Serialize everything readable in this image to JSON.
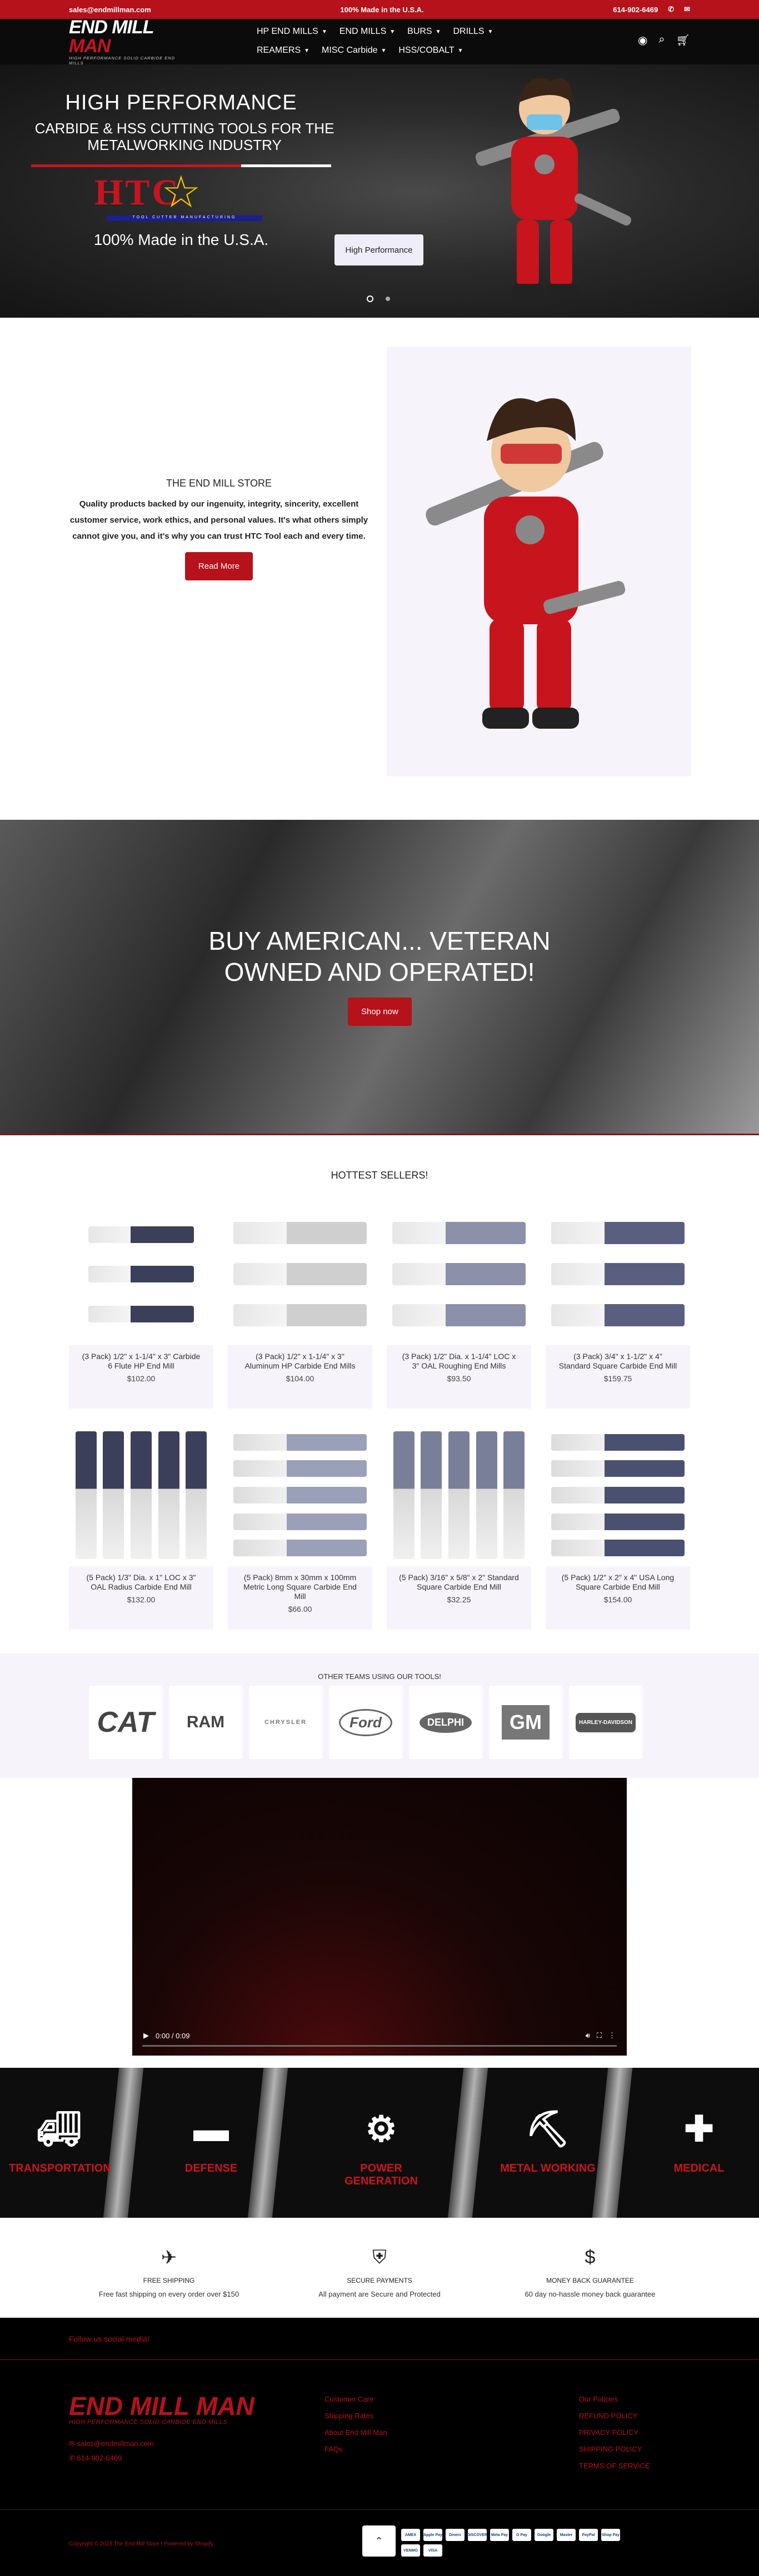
{
  "topbar": {
    "email": "sales@endmillman.com",
    "message": "100% Made in the U.S.A.",
    "phone": "614-902-6469",
    "icons": [
      "phone-icon",
      "mail-icon"
    ]
  },
  "header": {
    "logo_text_1": "END MILL ",
    "logo_text_2": "MAN",
    "logo_tagline": "HIGH PERFORMANCE SOLID CARBIDE END MILLS",
    "nav": [
      "HP END MILLS",
      "END MILLS",
      "BURS",
      "DRILLS",
      "REAMERS",
      "MISC Carbide",
      "HSS/COBALT"
    ],
    "icons": [
      "account-icon",
      "search-icon",
      "cart-icon"
    ]
  },
  "hero": {
    "title": "HIGH PERFORMANCE",
    "subtitle": "CARBIDE & HSS CUTTING TOOLS FOR THE METALWORKING INDUSTRY",
    "brand": "HTC",
    "brand_tagline": "TOOL CUTTER MANUFACTURING",
    "made": "100% Made in the U.S.A.",
    "button": "High Performance",
    "slide": "1 of 2"
  },
  "about": {
    "heading": "THE END MILL STORE",
    "body": "Quality products backed by our ingenuity, integrity, sincerity, excellent customer service, work ethics, and personal values. It's what others simply cannot give you, and it's why you can trust HTC Tool each and every time.",
    "button": "Read More"
  },
  "banner": {
    "line1": "BUY AMERICAN... VETERAN",
    "line2": "OWNED AND OPERATED!",
    "button": "Shop now"
  },
  "products": {
    "heading": "HOTTEST SELLERS!",
    "items": [
      {
        "title": "(3 Pack) 1/2\" x 1-1/4\" x 3\" Carbide 6 Flute HP End Mill",
        "price": "$102.00"
      },
      {
        "title": "(3 Pack) 1/2\" x 1-1/4\" x 3\" Aluminum HP Carbide End Mills",
        "price": "$104.00"
      },
      {
        "title": "(3 Pack) 1/2\" Dia. x 1-1/4\" LOC x 3\" OAL Roughing End Mills",
        "price": "$93.50"
      },
      {
        "title": "(3 Pack) 3/4\" x 1-1/2\" x 4\" Standard Square Carbide End Mill",
        "price": "$159.75"
      },
      {
        "title": "(5 Pack) 1/3\" Dia. x 1\" LOC x 3\" OAL Radius Carbide End Mill",
        "price": "$132.00"
      },
      {
        "title": "(5 Pack) 8mm x 30mm x 100mm Metric Long Square Carbide End Mill",
        "price": "$66.00"
      },
      {
        "title": "(5 Pack) 3/16\" x 5/8\" x 2\" Standard Square Carbide End Mill",
        "price": "$32.25"
      },
      {
        "title": "(5 Pack) 1/2\" x 2\" x 4\" USA Long Square Carbide End Mill",
        "price": "$154.00"
      }
    ]
  },
  "teams": {
    "heading": "OTHER TEAMS USING OUR TOOLS!",
    "logos": [
      "CAT",
      "RAM",
      "CHRYSLER",
      "Ford",
      "DELPHI",
      "GM",
      "HARLEY-DAVIDSON"
    ]
  },
  "video": {
    "time": "0:00 / 0:09"
  },
  "industries": [
    "TRANSPORTATION",
    "DEFENSE",
    "POWER GENERATION",
    "METAL WORKING",
    "MEDICAL"
  ],
  "features": [
    {
      "icon": "plane-icon",
      "title": "FREE SHIPPING",
      "desc": "Free fast shipping on every order over $150"
    },
    {
      "icon": "shield-icon",
      "title": "SECURE PAYMENTS",
      "desc": "All payment are Secure and Protected"
    },
    {
      "icon": "dollar-icon",
      "title": "MONEY BACK GUARANTEE",
      "desc": "60 day no-hassle money back guarantee"
    }
  ],
  "social": "Follow us social media!",
  "footer": {
    "logo": "END MILL MAN",
    "tagline": "HIGH PERFORMANCE SOLID CARBIDE END MILLS",
    "email": "sales@endmillman.com",
    "phone": "614-902-6469",
    "col1": [
      "Customer Care",
      "Shipping Rates",
      "About End Mill Man",
      "FAQs"
    ],
    "col2": [
      "Our Policies",
      "REFUND POLICY",
      "PRIVACY POLICY",
      "SHIPPING POLICY",
      "TERMS OF SERVICE"
    ]
  },
  "copyright": "Copyright © 2023 The End Mill Store | Powered by Shopify",
  "payments": [
    "AMEX",
    "Apple Pay",
    "Diners",
    "DISCOVER",
    "Meta Pay",
    "G Pay",
    "Google",
    "Master",
    "PayPal",
    "Shop Pay",
    "VENMO",
    "VISA"
  ],
  "colors": {
    "brand_red": "#b5121b",
    "dark": "#0b0b0b",
    "light_panel": "#f6f4fa"
  }
}
